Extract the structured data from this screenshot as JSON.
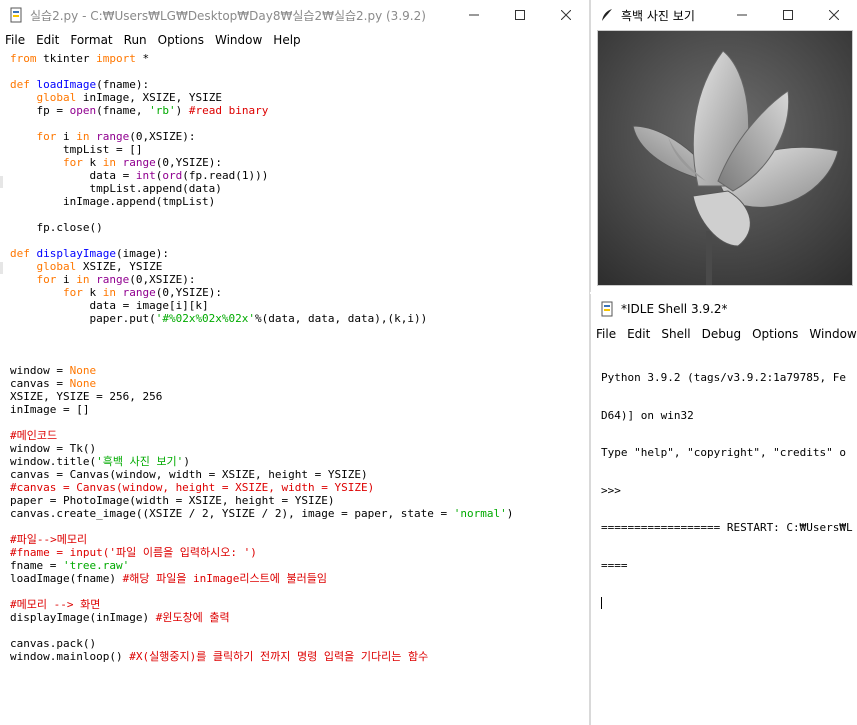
{
  "editor": {
    "title": "실습2.py - C:₩Users₩LG₩Desktop₩Day8₩실습2₩실습2.py (3.9.2)",
    "menu": [
      "File",
      "Edit",
      "Format",
      "Run",
      "Options",
      "Window",
      "Help"
    ],
    "code_lines": [
      "from tkinter import *",
      "",
      "def loadImage(fname):",
      "    global inImage, XSIZE, YSIZE",
      "    fp = open(fname, 'rb') #read binary",
      "",
      "    for i in range(0,XSIZE):",
      "        tmpList = []",
      "        for k in range(0,YSIZE):",
      "            data = int(ord(fp.read(1)))",
      "            tmpList.append(data)",
      "        inImage.append(tmpList)",
      "",
      "    fp.close()",
      "",
      "def displayImage(image):",
      "    global XSIZE, YSIZE",
      "    for i in range(0,XSIZE):",
      "        for k in range(0,YSIZE):",
      "            data = image[i][k]",
      "            paper.put('#%02x%02x%02x'%(data, data, data),(k,i))",
      "",
      "",
      "",
      "window = None",
      "canvas = None",
      "XSIZE, YSIZE = 256, 256",
      "inImage = []",
      "",
      "#메인코드",
      "window = Tk()",
      "window.title('흑백 사진 보기')",
      "canvas = Canvas(window, width = XSIZE, height = YSIZE)",
      "#canvas = Canvas(window, height = XSIZE, width = YSIZE)",
      "paper = PhotoImage(width = XSIZE, height = YSIZE)",
      "canvas.create_image((XSIZE / 2, YSIZE / 2), image = paper, state = 'normal')",
      "",
      "#파일-->메모리",
      "#fname = input('파일 이름을 입력하시오: ')",
      "fname = 'tree.raw'",
      "loadImage(fname) #해당 파일을 inImage리스트에 불러들임",
      "",
      "#메모리 --> 화면",
      "displayImage(inImage) #윈도창에 출력",
      "",
      "canvas.pack()",
      "window.mainloop() #X(실행중지)를 클릭하기 전까지 명령 입력을 기다리는 함수"
    ]
  },
  "image_window": {
    "title": "흑백 사진 보기"
  },
  "shell": {
    "title": "*IDLE Shell 3.9.2*",
    "menu": [
      "File",
      "Edit",
      "Shell",
      "Debug",
      "Options",
      "Window"
    ],
    "lines": [
      "Python 3.9.2 (tags/v3.9.2:1a79785, Fe",
      "D64)] on win32",
      "Type \"help\", \"copyright\", \"credits\" o",
      ">>> ",
      "================== RESTART: C:₩Users₩L",
      "===="
    ]
  },
  "colors": {
    "keyword": "#ff7700",
    "builtin": "#900090",
    "string": "#00aa00",
    "comment": "#dd0000",
    "definition": "#0000ff"
  }
}
